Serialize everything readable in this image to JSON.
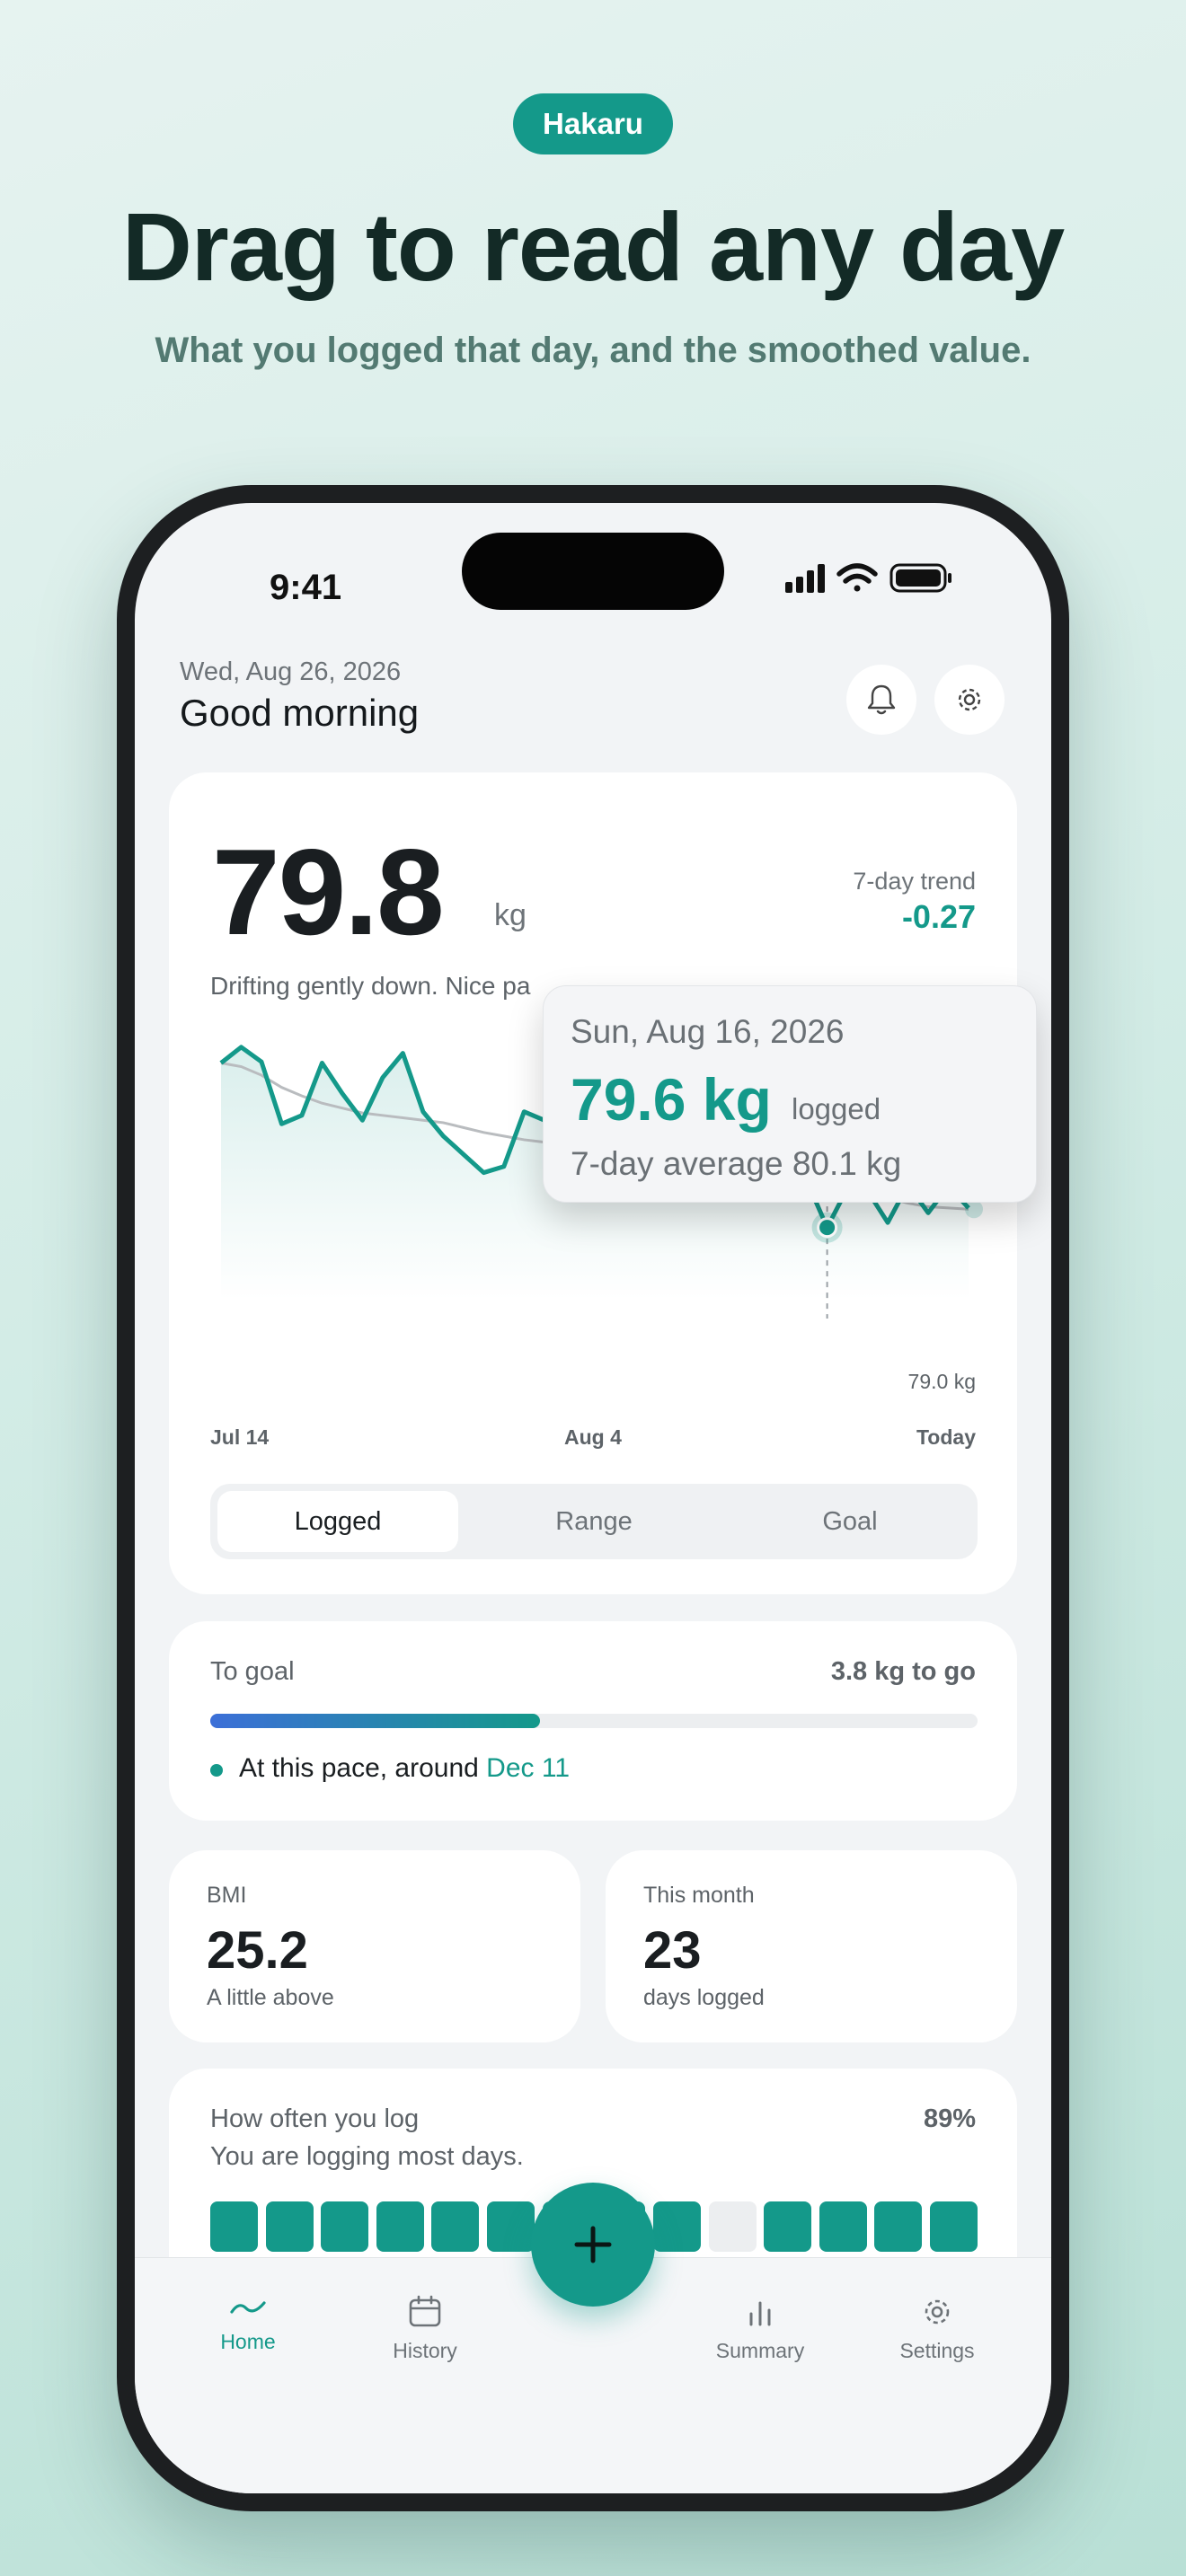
{
  "promo": {
    "badge": "Hakaru",
    "headline": "Drag to read any day",
    "subheadline": "What you logged that day, and the smoothed value."
  },
  "status_bar": {
    "time": "9:41"
  },
  "header": {
    "date": "Wed, Aug 26, 2026",
    "greeting": "Good morning"
  },
  "weight_card": {
    "value": "79.8",
    "unit": "kg",
    "trend_label": "7-day trend",
    "trend_value": "-0.27",
    "message": "Drifting gently down. Nice pa",
    "tooltip": {
      "date": "Sun, Aug 16, 2026",
      "value": "79.6 kg",
      "logged_label": "logged",
      "average": "7-day average 80.1 kg"
    },
    "min_label": "79.0 kg",
    "segments": [
      "Logged",
      "Range",
      "Goal"
    ],
    "active_segment": "Logged"
  },
  "chart_data": {
    "type": "line",
    "x_labels": [
      "Jul 14",
      "Aug 4",
      "Today"
    ],
    "series": [
      {
        "values": [
          80.95,
          81.08,
          80.96,
          80.45,
          80.52,
          80.95,
          80.7,
          80.48,
          80.83,
          81.03,
          80.55,
          80.35,
          80.2,
          80.05,
          80.1,
          80.55,
          80.48,
          80.2,
          80.52,
          80.45,
          80.6,
          80.1,
          80.22,
          80.1,
          79.9,
          80.3,
          80.2,
          79.85,
          80.3,
          79.98,
          79.6,
          79.92,
          79.9,
          79.64,
          79.95,
          79.72,
          79.94,
          79.76
        ]
      },
      {
        "values": [
          80.95,
          80.92,
          80.85,
          80.75,
          80.68,
          80.62,
          80.58,
          80.54,
          80.52,
          80.5,
          80.48,
          80.46,
          80.42,
          80.38,
          80.35,
          80.32,
          80.3,
          80.28,
          80.26,
          80.24,
          80.22,
          80.18,
          80.15,
          80.12,
          80.1,
          80.08,
          80.05,
          80.02,
          80.0,
          79.97,
          79.95,
          79.92,
          79.88,
          79.84,
          79.8,
          79.77,
          79.76,
          79.75
        ]
      }
    ],
    "ylim": [
      79.0,
      81.3
    ]
  },
  "goal_card": {
    "label": "To goal",
    "remaining": "3.8 kg to go",
    "progress": 0.43,
    "pace_text": "At this pace, around ",
    "pace_date": "Dec 11"
  },
  "bmi_card": {
    "label": "BMI",
    "value": "25.2",
    "sub": "A little above"
  },
  "month_card": {
    "label": "This month",
    "value": "23",
    "sub": "days logged"
  },
  "frequency_card": {
    "label": "How often you log",
    "percent": "89%",
    "sub": "You are logging most days.",
    "days": [
      true,
      true,
      true,
      true,
      true,
      true,
      true,
      true,
      true,
      false,
      true,
      true,
      true,
      true
    ]
  },
  "tabs": {
    "home": "Home",
    "history": "History",
    "summary": "Summary",
    "settings": "Settings"
  },
  "colors": {
    "accent": "#14998a",
    "smoothed": "#b9bcbf",
    "progress_start": "#3c6fd8"
  }
}
